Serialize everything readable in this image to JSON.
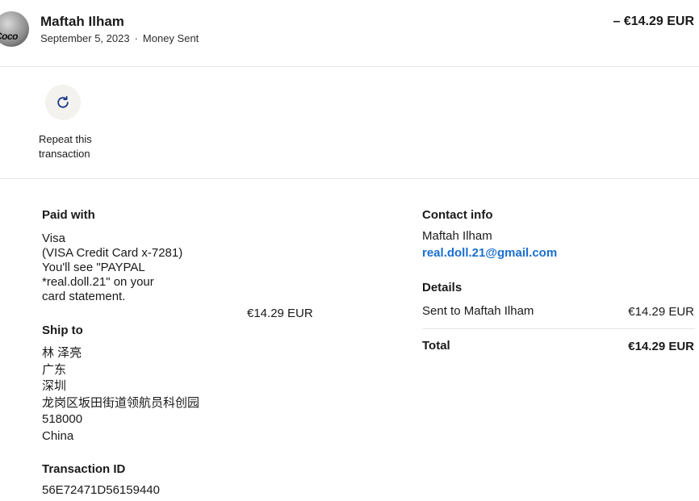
{
  "header": {
    "name": "Maftah Ilham",
    "date": "September 5, 2023",
    "separator": "·",
    "type": "Money Sent",
    "amount": "– €14.29 EUR",
    "avatar_text": "Coco"
  },
  "repeat": {
    "icon": "refresh-icon",
    "label_line1": "Repeat this",
    "label_line2": "transaction"
  },
  "paid_with": {
    "heading": "Paid with",
    "lines": [
      "Visa",
      "(VISA Credit Card x-7281)",
      "You'll see \"PAYPAL",
      "*real.doll.21\" on your",
      "card statement."
    ],
    "amount": "€14.29 EUR"
  },
  "ship_to": {
    "heading": "Ship to",
    "lines": [
      "林 泽亮",
      "广东",
      "深圳",
      "龙岗区坂田街道领航员科创园",
      "518000",
      "China"
    ]
  },
  "transaction_id": {
    "heading": "Transaction ID",
    "value": "56E72471D56159440"
  },
  "contact": {
    "heading": "Contact info",
    "name": "Maftah Ilham",
    "email": "real.doll.21@gmail.com"
  },
  "details": {
    "heading": "Details",
    "sent_to_label": "Sent to Maftah Ilham",
    "sent_to_amount": "€14.29 EUR",
    "total_label": "Total",
    "total_amount": "€14.29 EUR"
  },
  "colors": {
    "link": "#1a6fd0",
    "divider": "#e6e6e6",
    "repeat_bg": "#f3f2ee",
    "icon": "#1f3a8a"
  }
}
